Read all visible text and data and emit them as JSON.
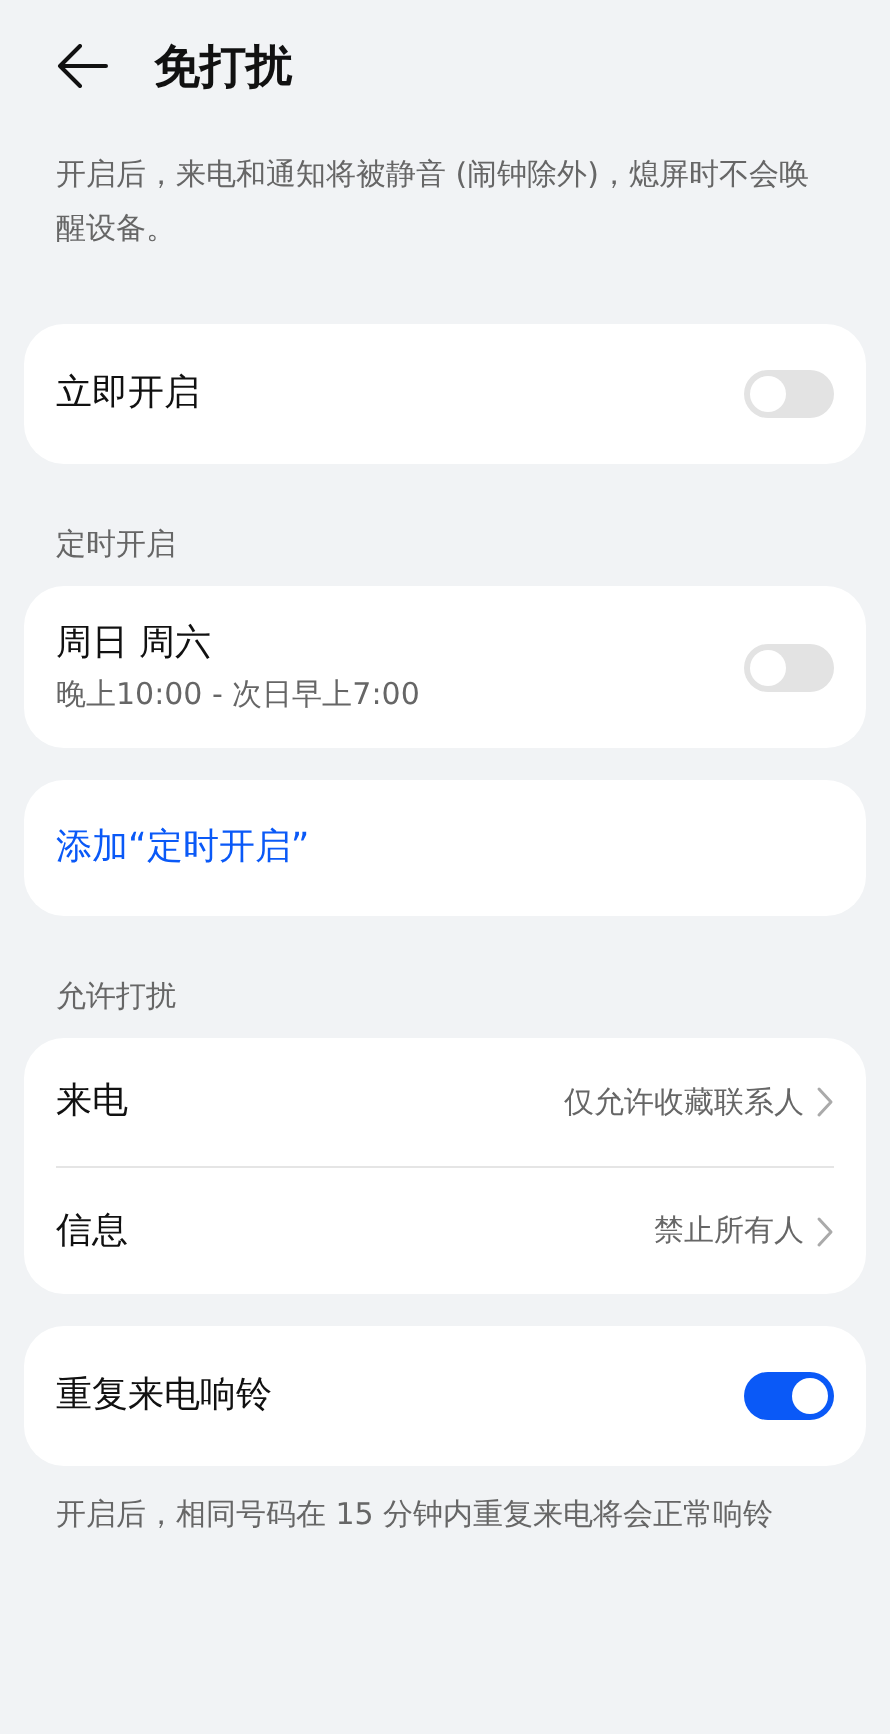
{
  "header": {
    "title": "免打扰"
  },
  "description": "开启后，来电和通知将被静音 (闹钟除外)，熄屏时不会唤醒设备。",
  "groups": [
    {
      "items": [
        {
          "kind": "toggle",
          "label": "立即开启",
          "on": false
        }
      ]
    },
    {
      "heading": "定时开启",
      "items": [
        {
          "kind": "toggle",
          "label": "周日 周六",
          "sublabel": "晚上10:00 - 次日早上7:00",
          "on": false
        }
      ]
    },
    {
      "items": [
        {
          "kind": "link",
          "label": "添加“定时开启”"
        }
      ]
    },
    {
      "heading": "允许打扰",
      "items": [
        {
          "kind": "nav",
          "label": "来电",
          "value": "仅允许收藏联系人"
        },
        {
          "kind": "nav",
          "label": "信息",
          "value": "禁止所有人"
        }
      ]
    },
    {
      "items": [
        {
          "kind": "toggle",
          "label": "重复来电响铃",
          "on": true
        }
      ]
    }
  ],
  "footnote": "开启后，相同号码在 15 分钟内重复来电将会正常响铃"
}
